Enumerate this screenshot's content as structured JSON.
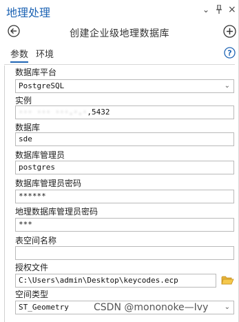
{
  "titlebar": {
    "title": "地理处理",
    "chevron_icon": "chevron-down-icon",
    "pin_icon": "pin-icon",
    "close_icon": "close-icon",
    "chevron_glyph": "⌄",
    "pin_glyph": "ᵖ",
    "close_glyph": "×"
  },
  "nav": {
    "title": "创建企业级地理数据库",
    "back_icon": "back-arrow-icon",
    "add_icon": "add-icon"
  },
  "tabs": [
    {
      "label": "参数",
      "active": true
    },
    {
      "label": "环境",
      "active": false
    }
  ],
  "help_icon": "help-icon",
  "params": {
    "platform": {
      "label": "数据库平台",
      "value": "PostgreSQL",
      "dropdown_glyph": "⌄"
    },
    "instance": {
      "label": "实例",
      "value_visible_suffix": ",5432",
      "value_redacted": "··· ··· ···.·.·"
    },
    "database": {
      "label": "数据库",
      "value": "sde"
    },
    "db_admin": {
      "label": "数据库管理员",
      "value": "postgres"
    },
    "db_admin_password": {
      "label": "数据库管理员密码",
      "value": "******"
    },
    "gdb_admin_password": {
      "label": "地理数据库管理员密码",
      "value": "***"
    },
    "tablespace": {
      "label": "表空间名称",
      "value": ""
    },
    "auth_file": {
      "label": "授权文件",
      "value": "C:\\Users\\admin\\Desktop\\keycodes.ecp"
    },
    "spatial_type": {
      "label": "空间类型",
      "value": "ST_Geometry",
      "dropdown_glyph": "⌄"
    }
  },
  "watermark": "CSDN @mononoke—Ivy",
  "colors": {
    "accent": "#1e64b4",
    "folder": "#e6b33a",
    "field_border": "#b9b9b9"
  }
}
